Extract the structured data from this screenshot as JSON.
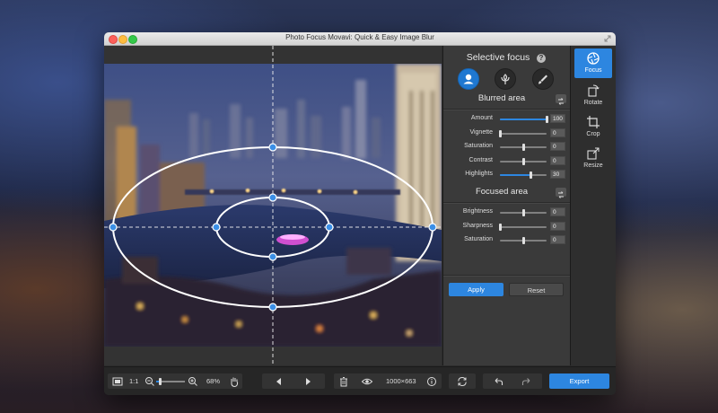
{
  "window": {
    "title": "Photo Focus Movavi: Quick & Easy Image Blur"
  },
  "panel": {
    "title": "Selective focus",
    "help_icon": "?",
    "modes": [
      {
        "name": "portrait-mode-icon",
        "active": true
      },
      {
        "name": "macro-mode-icon",
        "active": false
      },
      {
        "name": "brush-mode-icon",
        "active": false
      }
    ],
    "blurred": {
      "title": "Blurred area",
      "sliders": [
        {
          "label": "Amount",
          "value": "100",
          "level": 1.0,
          "filled": true
        },
        {
          "label": "Vignette",
          "value": "0",
          "level": 0.0,
          "filled": false
        },
        {
          "label": "Saturation",
          "value": "0",
          "level": 0.5,
          "filled": false
        },
        {
          "label": "Contrast",
          "value": "0",
          "level": 0.5,
          "filled": false
        },
        {
          "label": "Highlights",
          "value": "30",
          "level": 0.65,
          "filled": true
        }
      ]
    },
    "focused": {
      "title": "Focused area",
      "sliders": [
        {
          "label": "Brightness",
          "value": "0",
          "level": 0.5,
          "filled": false
        },
        {
          "label": "Sharpness",
          "value": "0",
          "level": 0.0,
          "filled": false
        },
        {
          "label": "Saturation",
          "value": "0",
          "level": 0.5,
          "filled": false
        }
      ]
    },
    "apply_label": "Apply",
    "reset_label": "Reset"
  },
  "tools": [
    {
      "label": "Focus",
      "icon": "aperture-icon",
      "active": true
    },
    {
      "label": "Rotate",
      "icon": "rotate-icon",
      "active": false
    },
    {
      "label": "Crop",
      "icon": "crop-icon",
      "active": false
    },
    {
      "label": "Resize",
      "icon": "resize-icon",
      "active": false
    }
  ],
  "bottombar": {
    "ratio_label": "1:1",
    "zoom": "68%",
    "image_size": "1000×663",
    "export_label": "Export"
  },
  "colors": {
    "accent": "#2d86e0",
    "focus_handle": "#3b8fe6"
  }
}
